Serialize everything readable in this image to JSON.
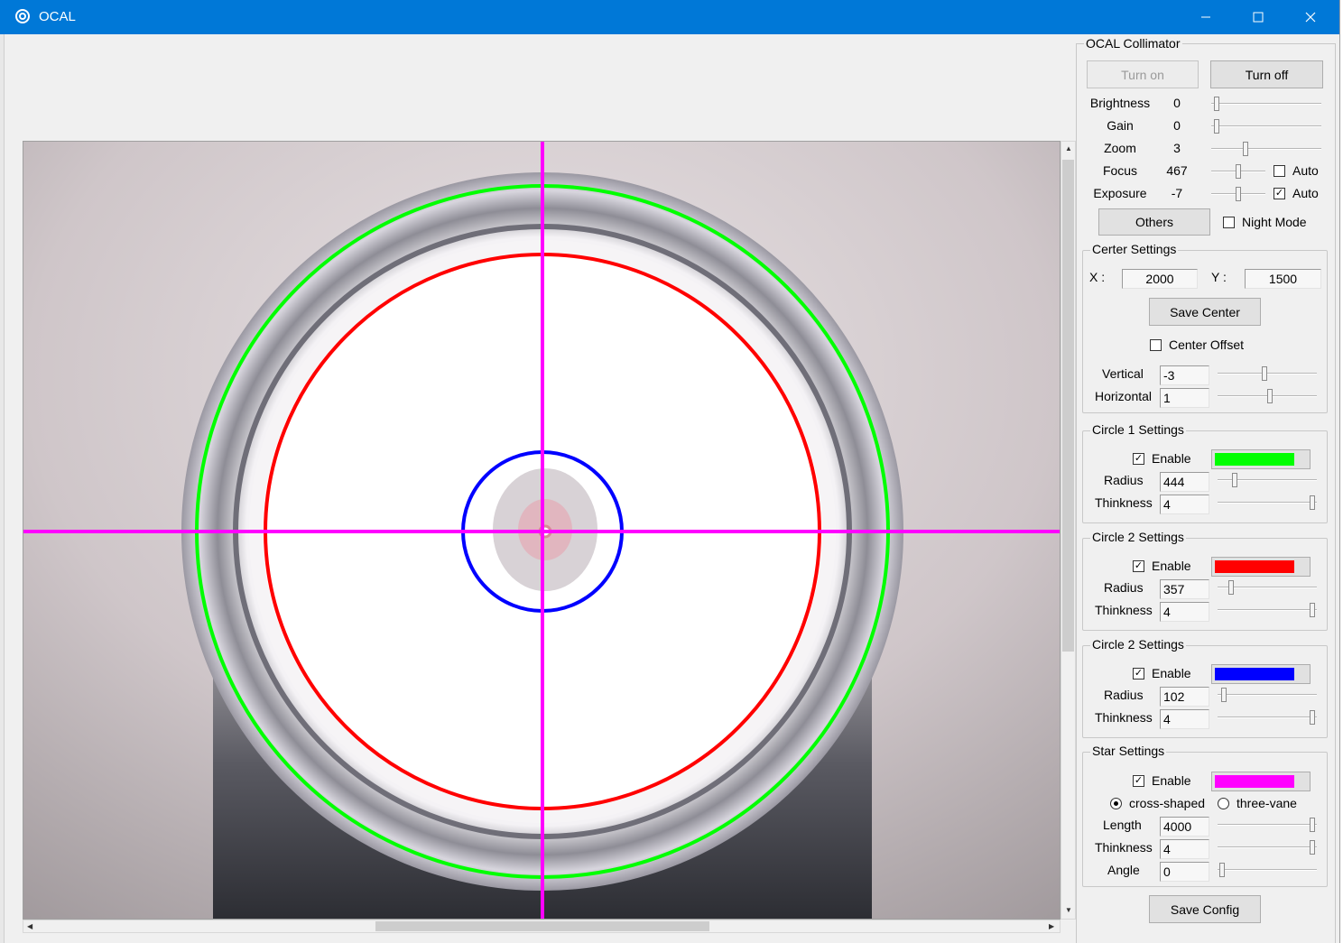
{
  "window": {
    "title": "OCAL"
  },
  "collimator": {
    "title": "OCAL Collimator",
    "turn_on": "Turn on",
    "turn_off": "Turn off",
    "controls": [
      {
        "label": "Brightness",
        "value": "0",
        "slider": 0.03
      },
      {
        "label": "Gain",
        "value": "0",
        "slider": 0.03
      },
      {
        "label": "Zoom",
        "value": "3",
        "slider": 0.3
      },
      {
        "label": "Focus",
        "value": "467",
        "slider": 0.5,
        "auto": {
          "label": "Auto",
          "checked": false
        }
      },
      {
        "label": "Exposure",
        "value": "-7",
        "slider": 0.5,
        "auto": {
          "label": "Auto",
          "checked": true
        }
      }
    ],
    "others": "Others",
    "night_mode": {
      "label": "Night Mode",
      "checked": false
    }
  },
  "center": {
    "title": "Certer Settings",
    "x_label": "X :",
    "x_value": "2000",
    "y_label": "Y :",
    "y_value": "1500",
    "save": "Save Center",
    "offset": {
      "label": "Center Offset",
      "checked": false
    },
    "vertical": {
      "label": "Vertical",
      "value": "-3",
      "slider": 0.47
    },
    "horizontal": {
      "label": "Horizontal",
      "value": "1",
      "slider": 0.53
    }
  },
  "circles": [
    {
      "title": "Circle 1 Settings",
      "enable": "Enable",
      "checked": true,
      "color": "#00ff00",
      "radius_label": "Radius",
      "radius": "444",
      "radius_slider": 0.15,
      "thick_label": "Thinkness",
      "thick": "4",
      "thick_slider": 0.98
    },
    {
      "title": "Circle 2 Settings",
      "enable": "Enable",
      "checked": true,
      "color": "#ff0000",
      "radius_label": "Radius",
      "radius": "357",
      "radius_slider": 0.12,
      "thick_label": "Thinkness",
      "thick": "4",
      "thick_slider": 0.98
    },
    {
      "title": "Circle 2 Settings",
      "enable": "Enable",
      "checked": true,
      "color": "#0000ff",
      "radius_label": "Radius",
      "radius": "102",
      "radius_slider": 0.04,
      "thick_label": "Thinkness",
      "thick": "4",
      "thick_slider": 0.98
    }
  ],
  "star": {
    "title": "Star Settings",
    "enable": "Enable",
    "checked": true,
    "color": "#ff00ff",
    "cross": "cross-shaped",
    "three": "three-vane",
    "length_label": "Length",
    "length": "4000",
    "length_slider": 0.98,
    "thick_label": "Thinkness",
    "thick": "4",
    "thick_slider": 0.98,
    "angle_label": "Angle",
    "angle": "0",
    "angle_slider": 0.02
  },
  "save_config": "Save Config",
  "overlay_colors": {
    "circle1": "#00ff00",
    "circle2": "#ff0000",
    "circle3": "#0000ff",
    "star": "#ff00ff"
  }
}
